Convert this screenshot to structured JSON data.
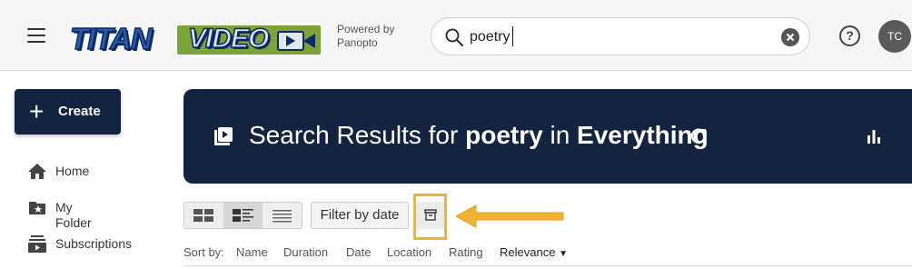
{
  "header": {
    "logo": {
      "part1": "TITAN",
      "part2": "VIDEO",
      "brand_colors": {
        "blue": "#2b5aa8",
        "green": "#7ea23a",
        "navy": "#0b2a66"
      }
    },
    "powered_by": {
      "line1": "Powered by",
      "line2": "Panopto"
    },
    "search": {
      "value": "poetry",
      "icon": "search-icon",
      "clear_icon": "clear-icon"
    },
    "help_icon": "help-icon",
    "avatar_initials": "TC"
  },
  "sidebar": {
    "create_label": "Create",
    "items": [
      {
        "label": "Home",
        "icon": "home-icon"
      },
      {
        "label": "My Folder",
        "icon": "folder-star-icon"
      },
      {
        "label": "Subscriptions",
        "icon": "subscriptions-icon"
      }
    ]
  },
  "banner": {
    "prefix": "Search Results for ",
    "query": "poetry",
    "middle": " in ",
    "scope": "Everything",
    "background": "#14233f"
  },
  "toolbar": {
    "views": [
      "grid-view",
      "detail-view",
      "list-view"
    ],
    "active_view": "detail-view",
    "filter_label": "Filter by date",
    "archive_icon": "archive-icon",
    "annotation_color": "#f2b234"
  },
  "sort": {
    "label": "Sort by:",
    "options": [
      "Name",
      "Duration",
      "Date",
      "Location",
      "Rating",
      "Relevance"
    ],
    "selected": "Relevance"
  }
}
